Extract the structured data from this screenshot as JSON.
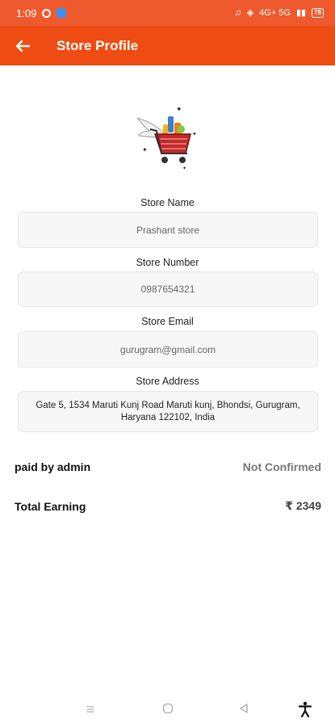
{
  "status_bar": {
    "time": "1:09",
    "signal_text": "4G+ 5G",
    "battery": "78"
  },
  "app_bar": {
    "back_icon": "arrow-left-icon",
    "title": "Store Profile"
  },
  "logo": {
    "icon": "shopping-cart-with-wings-icon",
    "colors": {
      "cart": "#c62828",
      "wing": "#e8e8e8",
      "grocery": "#f57c00"
    }
  },
  "fields": [
    {
      "label": "Store Name",
      "value": "Prashant store"
    },
    {
      "label": "Store Number",
      "value": "0987654321"
    },
    {
      "label": "Store Email",
      "value": "gurugram@gmail.com"
    },
    {
      "label": "Store Address",
      "value": "Gate 5, 1534 Maruti Kunj Road Maruti kunj, Bhondsi, Gurugram, Haryana 122102, India"
    }
  ],
  "payment": {
    "label": "paid by admin",
    "value": "Not Confirmed"
  },
  "earning": {
    "label": "Total Earning",
    "value": "₹ 2349"
  },
  "nav": {
    "menu_icon": "menu-icon",
    "home_icon": "home-circle-icon",
    "back_icon": "triangle-back-icon",
    "accessibility_icon": "accessibility-icon"
  },
  "colors": {
    "status_bar": "#ee5a2e",
    "app_bar": "#ee4c12",
    "field_bg": "#f7f7f7"
  }
}
